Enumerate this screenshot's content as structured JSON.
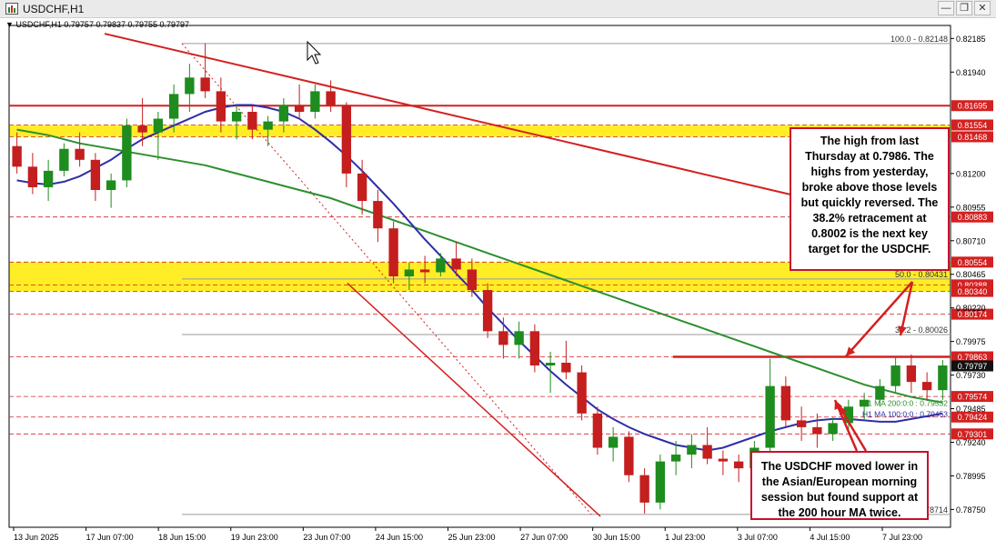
{
  "window": {
    "title": "USDCHF,H1",
    "minimize_label": "—",
    "restore_label": "❐",
    "close_label": "✕"
  },
  "symbol_info": "▼ USDCHF,H1 0.79757 0.79837 0.79755 0.79797",
  "annotations": {
    "upper_note": "The high from last Thursday at 0.7986. The highs from yesterday, broke above those levels but quickly reversed. The 38.2% retracement at 0.8002 is the next key target for the USDCHF.",
    "lower_note": "The USDCHF moved lower in the Asian/European morning session but found support at the 200 hour MA twice."
  },
  "chart_data": {
    "type": "candlestick",
    "x_labels": [
      "13 Jun 2025",
      "17 Jun 07:00",
      "18 Jun 15:00",
      "19 Jun 23:00",
      "23 Jun 07:00",
      "24 Jun 15:00",
      "25 Jun 23:00",
      "27 Jun 07:00",
      "30 Jun 15:00",
      "1 Jul 23:00",
      "3 Jul 07:00",
      "4 Jul 15:00",
      "7 Jul 23:00"
    ],
    "y_ticks": [
      "0.82185",
      "0.81940",
      "0.81200",
      "0.80955",
      "0.80710",
      "0.80465",
      "0.80220",
      "0.79975",
      "0.79730",
      "0.79485",
      "0.79240",
      "0.78995",
      "0.78750"
    ],
    "y_range": [
      0.7862,
      0.8228
    ],
    "price_levels": [
      {
        "label": "0.81695",
        "value": 0.81695,
        "color": "#d42020"
      },
      {
        "label": "0.81554",
        "value": 0.81554,
        "color": "#d42020"
      },
      {
        "label": "0.81468",
        "value": 0.81468,
        "color": "#d42020"
      },
      {
        "label": "0.80883",
        "value": 0.80883,
        "color": "#d42020"
      },
      {
        "label": "0.80554",
        "value": 0.80554,
        "color": "#d42020"
      },
      {
        "label": "0.80388",
        "value": 0.80388,
        "color": "#d42020"
      },
      {
        "label": "0.80340",
        "value": 0.8034,
        "color": "#d42020"
      },
      {
        "label": "0.80174",
        "value": 0.80174,
        "color": "#d42020"
      },
      {
        "label": "0.79863",
        "value": 0.79863,
        "color": "#d42020"
      },
      {
        "label": "0.79797",
        "value": 0.79797,
        "color": "#111111"
      },
      {
        "label": "0.79574",
        "value": 0.79574,
        "color": "#d42020"
      },
      {
        "label": "0.79424",
        "value": 0.79424,
        "color": "#d42020"
      },
      {
        "label": "0.79301",
        "value": 0.79301,
        "color": "#d42020"
      }
    ],
    "fib_levels": [
      {
        "label": "100.0 - 0.82148",
        "value": 0.82148
      },
      {
        "label": "50.0 - 0.80431",
        "value": 0.80431
      },
      {
        "label": "38.2 - 0.80026",
        "value": 0.80026
      },
      {
        "label": ".78714",
        "value": 0.78714
      }
    ],
    "ma_labels": [
      {
        "label": "H1 MA 200:0:0 : 0.79532",
        "value": 0.79532,
        "color": "#2d8f2d"
      },
      {
        "label": "H1 MA 100:0:0 : 0.79453",
        "value": 0.79453,
        "color": "#2e2ea8"
      }
    ],
    "support_zones": [
      {
        "top": 0.81554,
        "bottom": 0.81468
      },
      {
        "top": 0.80554,
        "bottom": 0.8034
      }
    ],
    "candles": [
      [
        0.814,
        0.815,
        0.812,
        0.8125
      ],
      [
        0.8125,
        0.8135,
        0.8105,
        0.811
      ],
      [
        0.811,
        0.813,
        0.81,
        0.8122
      ],
      [
        0.8122,
        0.8142,
        0.8118,
        0.8138
      ],
      [
        0.8138,
        0.815,
        0.8125,
        0.813
      ],
      [
        0.813,
        0.8135,
        0.81,
        0.8108
      ],
      [
        0.8108,
        0.812,
        0.8095,
        0.8115
      ],
      [
        0.8115,
        0.816,
        0.811,
        0.8155
      ],
      [
        0.8155,
        0.8175,
        0.814,
        0.815
      ],
      [
        0.815,
        0.8165,
        0.813,
        0.816
      ],
      [
        0.816,
        0.8185,
        0.815,
        0.8178
      ],
      [
        0.8178,
        0.82,
        0.8165,
        0.819
      ],
      [
        0.819,
        0.8215,
        0.8175,
        0.818
      ],
      [
        0.818,
        0.819,
        0.815,
        0.8158
      ],
      [
        0.8158,
        0.817,
        0.8145,
        0.8165
      ],
      [
        0.8165,
        0.817,
        0.8145,
        0.8152
      ],
      [
        0.8152,
        0.8162,
        0.814,
        0.8158
      ],
      [
        0.8158,
        0.8175,
        0.815,
        0.817
      ],
      [
        0.817,
        0.8185,
        0.816,
        0.8165
      ],
      [
        0.8165,
        0.8185,
        0.816,
        0.818
      ],
      [
        0.818,
        0.8188,
        0.8165,
        0.817
      ],
      [
        0.817,
        0.8172,
        0.811,
        0.812
      ],
      [
        0.812,
        0.813,
        0.809,
        0.81
      ],
      [
        0.81,
        0.8108,
        0.807,
        0.808
      ],
      [
        0.808,
        0.8085,
        0.804,
        0.8045
      ],
      [
        0.8045,
        0.8055,
        0.8035,
        0.805
      ],
      [
        0.805,
        0.806,
        0.804,
        0.8048
      ],
      [
        0.8048,
        0.8062,
        0.8045,
        0.8058
      ],
      [
        0.8058,
        0.807,
        0.8045,
        0.805
      ],
      [
        0.805,
        0.8058,
        0.803,
        0.8035
      ],
      [
        0.8035,
        0.804,
        0.8,
        0.8005
      ],
      [
        0.8005,
        0.8015,
        0.7985,
        0.7995
      ],
      [
        0.7995,
        0.8012,
        0.7985,
        0.8005
      ],
      [
        0.8005,
        0.801,
        0.7975,
        0.798
      ],
      [
        0.798,
        0.799,
        0.796,
        0.7982
      ],
      [
        0.7982,
        0.7998,
        0.797,
        0.7975
      ],
      [
        0.7975,
        0.798,
        0.794,
        0.7945
      ],
      [
        0.7945,
        0.795,
        0.7915,
        0.792
      ],
      [
        0.792,
        0.7935,
        0.791,
        0.7928
      ],
      [
        0.7928,
        0.7932,
        0.7895,
        0.79
      ],
      [
        0.79,
        0.7905,
        0.7872,
        0.788
      ],
      [
        0.788,
        0.7915,
        0.7875,
        0.791
      ],
      [
        0.791,
        0.7925,
        0.79,
        0.7915
      ],
      [
        0.7915,
        0.793,
        0.7905,
        0.7922
      ],
      [
        0.7922,
        0.7935,
        0.7908,
        0.7912
      ],
      [
        0.7912,
        0.7918,
        0.79,
        0.791
      ],
      [
        0.791,
        0.7915,
        0.7895,
        0.7905
      ],
      [
        0.7905,
        0.7925,
        0.79,
        0.792
      ],
      [
        0.792,
        0.7985,
        0.7915,
        0.7965
      ],
      [
        0.7965,
        0.7972,
        0.7935,
        0.794
      ],
      [
        0.794,
        0.795,
        0.7925,
        0.7935
      ],
      [
        0.7935,
        0.7945,
        0.792,
        0.793
      ],
      [
        0.793,
        0.7942,
        0.7925,
        0.7938
      ],
      [
        0.7938,
        0.7955,
        0.7932,
        0.795
      ],
      [
        0.795,
        0.796,
        0.794,
        0.7955
      ],
      [
        0.7955,
        0.797,
        0.795,
        0.7965
      ],
      [
        0.7965,
        0.7986,
        0.796,
        0.798
      ],
      [
        0.798,
        0.7988,
        0.796,
        0.7968
      ],
      [
        0.7968,
        0.7975,
        0.7955,
        0.7962
      ],
      [
        0.7962,
        0.7984,
        0.7955,
        0.798
      ]
    ],
    "ma200": [
      0.8152,
      0.815,
      0.8148,
      0.8145,
      0.8142,
      0.814,
      0.8138,
      0.8136,
      0.8134,
      0.8132,
      0.813,
      0.8128,
      0.8126,
      0.8123,
      0.812,
      0.8117,
      0.8114,
      0.8111,
      0.8108,
      0.8105,
      0.8102,
      0.8098,
      0.8094,
      0.809,
      0.8086,
      0.8082,
      0.8078,
      0.8074,
      0.807,
      0.8066,
      0.8062,
      0.8058,
      0.8054,
      0.805,
      0.8046,
      0.8042,
      0.8038,
      0.8034,
      0.803,
      0.8026,
      0.8022,
      0.8018,
      0.8014,
      0.801,
      0.8006,
      0.8002,
      0.7998,
      0.7994,
      0.799,
      0.7986,
      0.7982,
      0.7978,
      0.7974,
      0.797,
      0.7966,
      0.7963,
      0.796,
      0.7957,
      0.7955,
      0.7953
    ],
    "ma100": [
      0.8115,
      0.8113,
      0.8112,
      0.8114,
      0.8118,
      0.8124,
      0.813,
      0.8138,
      0.8145,
      0.815,
      0.8155,
      0.816,
      0.8165,
      0.8168,
      0.817,
      0.817,
      0.8168,
      0.8165,
      0.816,
      0.8152,
      0.8143,
      0.8133,
      0.8122,
      0.811,
      0.8098,
      0.8085,
      0.8072,
      0.806,
      0.8047,
      0.8035,
      0.8022,
      0.801,
      0.7998,
      0.7987,
      0.7976,
      0.7966,
      0.7957,
      0.7948,
      0.7941,
      0.7935,
      0.793,
      0.7926,
      0.7922,
      0.792,
      0.7918,
      0.792,
      0.7924,
      0.7928,
      0.7932,
      0.7935,
      0.7938,
      0.794,
      0.7941,
      0.7941,
      0.794,
      0.7939,
      0.7939,
      0.7941,
      0.7943,
      0.7945
    ]
  }
}
